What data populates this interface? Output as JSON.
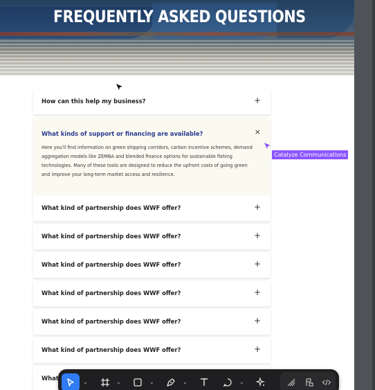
{
  "hero": {
    "title": "FREQUENTLY ASKED QUESTIONS"
  },
  "faq": {
    "items": [
      {
        "question": "How can this help my business?",
        "toggle": "+"
      },
      {
        "question": "What kinds of support or financing are available?",
        "toggle": "×",
        "answer": "Here you'll find information on green shipping corridors, carbon incentive schemes, demand aggregation models like ZEMBA and blended finance options for sustainable fishing technologies. Many of these tools are designed to reduce the upfront costs of going green and improve your long-term market access and resilience."
      },
      {
        "question": "What kind of partnership does WWF offer?",
        "toggle": "+"
      },
      {
        "question": "What kind of partnership does WWF offer?",
        "toggle": "+"
      },
      {
        "question": "What kind of partnership does WWF offer?",
        "toggle": "+"
      },
      {
        "question": "What kind of partnership does WWF offer?",
        "toggle": "+"
      },
      {
        "question": "What kind of partnership does WWF offer?",
        "toggle": "+"
      },
      {
        "question": "What kind of partnership does WWF offer?",
        "toggle": "+"
      },
      {
        "question": "What",
        "toggle": ""
      }
    ]
  },
  "collaborator": {
    "name": "Catalyze Communications",
    "color": "#8b55ff"
  },
  "toolbar": {
    "tools": [
      "move-tool",
      "frame-tool",
      "shape-tool",
      "pen-tool",
      "text-tool",
      "comment-tool",
      "ai-actions-tool"
    ],
    "modes": [
      "design-mode",
      "prototype-mode",
      "dev-mode"
    ],
    "active_color": "#2f7cf6"
  }
}
